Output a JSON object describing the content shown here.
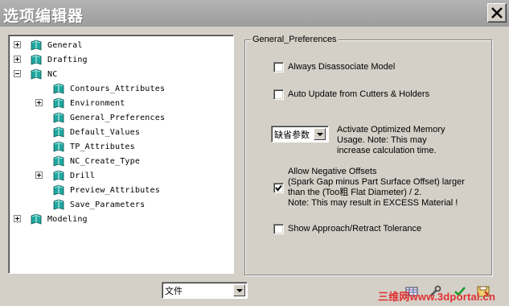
{
  "window": {
    "title": "选项编辑器",
    "close_icon": "close-icon"
  },
  "tree": {
    "items": [
      {
        "label": "General",
        "expander": "plus",
        "level": 0
      },
      {
        "label": "Drafting",
        "expander": "plus",
        "level": 0
      },
      {
        "label": "NC",
        "expander": "minus",
        "level": 0
      },
      {
        "label": "Contours_Attributes",
        "expander": "none",
        "level": 1
      },
      {
        "label": "Environment",
        "expander": "plus",
        "level": 1
      },
      {
        "label": "General_Preferences",
        "expander": "none",
        "level": 1
      },
      {
        "label": "Default_Values",
        "expander": "none",
        "level": 1
      },
      {
        "label": "TP_Attributes",
        "expander": "none",
        "level": 1
      },
      {
        "label": "NC_Create_Type",
        "expander": "none",
        "level": 1
      },
      {
        "label": "Drill",
        "expander": "plus",
        "level": 1
      },
      {
        "label": "Preview_Attributes",
        "expander": "none",
        "level": 1
      },
      {
        "label": "Save_Parameters",
        "expander": "none",
        "level": 1
      },
      {
        "label": "Modeling",
        "expander": "plus",
        "level": 0
      }
    ]
  },
  "prefs": {
    "group_title": "General_Preferences",
    "always_disassociate": {
      "label": "Always Disassociate Model",
      "checked": false
    },
    "auto_update": {
      "label": "Auto Update from Cutters & Holders",
      "checked": false
    },
    "memory_select": {
      "value": "缺省参数"
    },
    "memory_text": {
      "line1": "Activate Optimized Memory",
      "line2": "Usage. Note: This may",
      "line3": "increase calculation time."
    },
    "negative_offsets": {
      "checked": true,
      "line1": "Allow Negative Offsets",
      "line2": "(Spark Gap minus Part Surface Offset) larger",
      "line3": "than the (Too粗 Flat Diameter) / 2.",
      "line4": "Note: This may result in EXCESS Material !"
    },
    "show_tolerance": {
      "label": "Show Approach/Retract Tolerance",
      "checked": false
    }
  },
  "footer": {
    "file_select": {
      "value": "文件"
    },
    "watermark": "三维网www.3dportal.cn",
    "tool_icons": [
      "grid-icon",
      "wrench-icon",
      "check-icon",
      "save-icon"
    ]
  },
  "colors": {
    "titlebar": "#a9a9a9",
    "dialog": "#d4d0c8",
    "book_icon": "#1fa7a0"
  }
}
